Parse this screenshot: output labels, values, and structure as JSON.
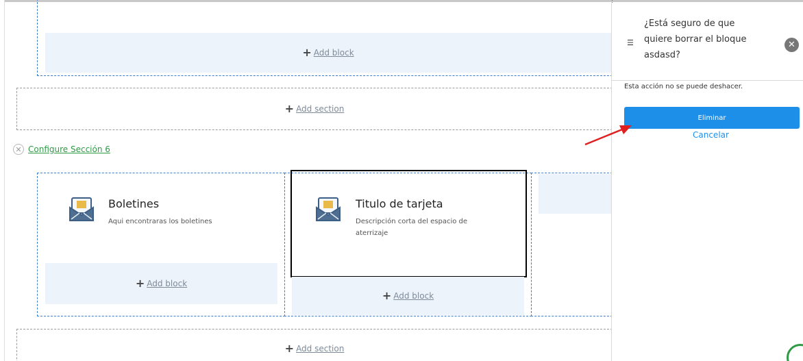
{
  "editor": {
    "add_block": "Add block",
    "add_section": "Add section",
    "configure_label": "Configure Sección 6",
    "cards": [
      {
        "title": "Boletines",
        "description": "Aqui encontraras los boletines"
      },
      {
        "title": "Titulo de tarjeta",
        "description": "Descripción corta del espacio de aterrizaje"
      }
    ]
  },
  "panel": {
    "question": "¿Está seguro de que quiere borrar el bloque asdasd?",
    "warning": "Esta acción no se puede deshacer.",
    "confirm_label": "Eliminar",
    "cancel_label": "Cancelar"
  },
  "colors": {
    "accent": "#1e8fe8",
    "configure_link": "#2e9a44",
    "block_bg": "#edf3fb",
    "arrow": "#e02020"
  },
  "icons": [
    "plus-icon",
    "close-circle-icon",
    "newsletter-envelope-icon",
    "menu-lines-icon",
    "close-icon"
  ]
}
